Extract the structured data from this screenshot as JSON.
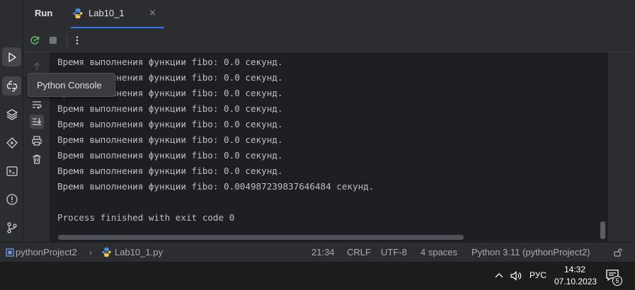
{
  "run_panel": {
    "title": "Run",
    "tab": {
      "label": "Lab10_1",
      "close": "×"
    }
  },
  "tooltip": "Python Console",
  "console": {
    "lines": [
      "Время выполнения функции fibo: 0.0 секунд.",
      "Время выполнения функции fibo: 0.0 секунд.",
      "Время выполнения функции fibo: 0.0 секунд.",
      "Время выполнения функции fibo: 0.0 секунд.",
      "Время выполнения функции fibo: 0.0 секунд.",
      "Время выполнения функции fibo: 0.0 секунд.",
      "Время выполнения функции fibo: 0.0 секунд.",
      "Время выполнения функции fibo: 0.0 секунд.",
      "Время выполнения функции fibo: 0.004987239837646484 секунд.",
      "",
      "Process finished with exit code 0"
    ]
  },
  "statusbar": {
    "project": "pythonProject2",
    "separator": "›",
    "file": "Lab10_1.py",
    "position": "21:34",
    "line_ending": "CRLF",
    "encoding": "UTF-8",
    "indent": "4 spaces",
    "interpreter": "Python 3.11 (pythonProject2)"
  },
  "taskbar": {
    "language": "РУС",
    "time": "14:32",
    "date": "07.10.2023",
    "notifications": "5"
  },
  "icons": {
    "left_strip": [
      "run-icon",
      "python-console-icon",
      "layers-icon",
      "services-icon",
      "terminal-icon",
      "problems-icon",
      "git-icon"
    ],
    "toolbar": [
      "rerun-icon",
      "stop-icon",
      "more-icon"
    ],
    "side_tools": [
      "scroll-up-icon",
      "soft-wrap-icon",
      "scroll-to-end-icon",
      "print-icon",
      "trash-icon"
    ]
  },
  "colors": {
    "accent": "#3574f0",
    "rerun": "#5fb865",
    "python_blue": "#4a8fd6",
    "python_yellow": "#f2c94c"
  }
}
